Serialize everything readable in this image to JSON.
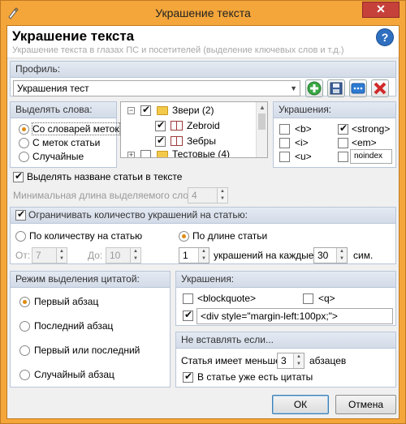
{
  "window": {
    "title": "Украшение текста",
    "close_label": "✕"
  },
  "header": {
    "title": "Украшение текста",
    "subtitle": "Украшение текста в глазах ПС и посетителей (выделение ключевых слов и т.д.)",
    "help_label": "?"
  },
  "profile": {
    "label": "Профиль:",
    "value": "Украшения тест"
  },
  "highlight_words": {
    "title": "Выделять слова:",
    "options": [
      "Со словарей меток",
      "С меток статьи",
      "Случайные"
    ],
    "selected": 0
  },
  "tree": {
    "items": [
      {
        "label": "Звери (2)",
        "checked": true,
        "type": "folder",
        "expanded": true
      },
      {
        "label": "Zebroid",
        "checked": true,
        "type": "book"
      },
      {
        "label": "Зебры",
        "checked": true,
        "type": "book"
      },
      {
        "label": "Тестовые (4)",
        "checked": false,
        "type": "folder",
        "expanded": false
      }
    ]
  },
  "decorations_top": {
    "title": "Украшения:",
    "items": [
      {
        "label": "<b>",
        "checked": false
      },
      {
        "label": "<strong>",
        "checked": true
      },
      {
        "label": "<i>",
        "checked": false
      },
      {
        "label": "<em>",
        "checked": false
      },
      {
        "label": "<u>",
        "checked": false
      },
      {
        "label": "noindex",
        "checked": false
      }
    ]
  },
  "highlight_title": {
    "label": "Выделять назване статьи в тексте",
    "checked": true,
    "min_length_label": "Минимальная длина выделяемого слова:",
    "min_length_value": "4"
  },
  "limit": {
    "label": "Ограничивать количество украшений на статью:",
    "checked": true,
    "by_count_label": "По количеству на статью",
    "by_length_label": "По длине статьи",
    "selected": 1,
    "from_label": "От:",
    "from_value": "7",
    "to_label": "До:",
    "to_value": "10",
    "per_value": "1",
    "per_label": "украшений на каждые",
    "chars_value": "30",
    "chars_label": "сим."
  },
  "quote_mode": {
    "title": "Режим выделения цитатой:",
    "options": [
      "Первый абзац",
      "Последний абзац",
      "Первый или последний",
      "Случайный абзац"
    ],
    "selected": 0
  },
  "decorations_bottom": {
    "title": "Украшения:",
    "blockquote_label": "<blockquote>",
    "blockquote_checked": false,
    "q_label": "<q>",
    "q_checked": false,
    "div_checked": true,
    "div_value": "<div style=\"margin-left:100px;\">"
  },
  "dont_insert": {
    "title": "Не вставлять если...",
    "less_label": "Статья имеет меньше",
    "less_value": "3",
    "paragraphs_label": "абзацев",
    "has_quotes_label": "В статье уже есть цитаты",
    "has_quotes_checked": true
  },
  "buttons": {
    "ok": "ОК",
    "cancel": "Отмена"
  }
}
